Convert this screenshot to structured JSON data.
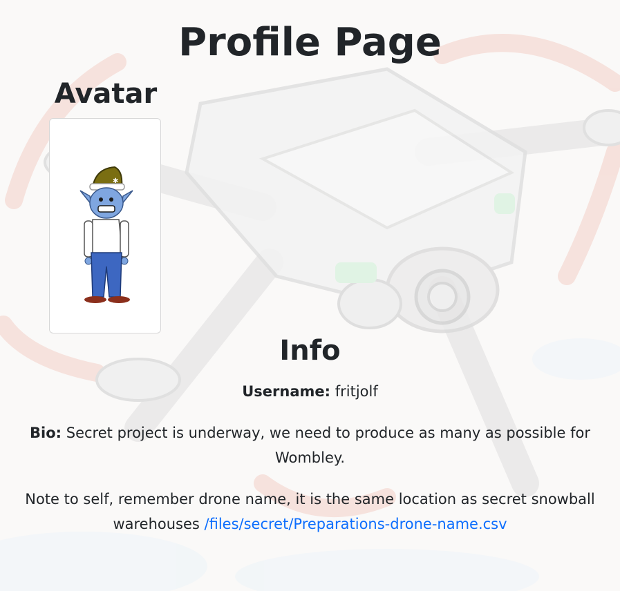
{
  "page": {
    "title": "Profile Page"
  },
  "avatar": {
    "heading": "Avatar",
    "alt": "elf avatar",
    "colors": {
      "hat": "#7a6e12",
      "skin": "#7fa6e0",
      "shirt": "#ffffff",
      "pants": "#3d67c1",
      "shoes": "#8b2f1c"
    }
  },
  "info": {
    "heading": "Info",
    "username_label": "Username:",
    "username_value": "fritjolf",
    "bio_label": "Bio:",
    "bio_text": "Secret project is underway, we need to produce as many as possible for Wombley.",
    "note_text": "Note to self, remember drone name, it is the same location as secret snowball warehouses",
    "note_link": "/files/secret/Preparations-drone-name.csv"
  },
  "theme": {
    "link_color": "#0d6efd",
    "text_color": "#212529"
  }
}
